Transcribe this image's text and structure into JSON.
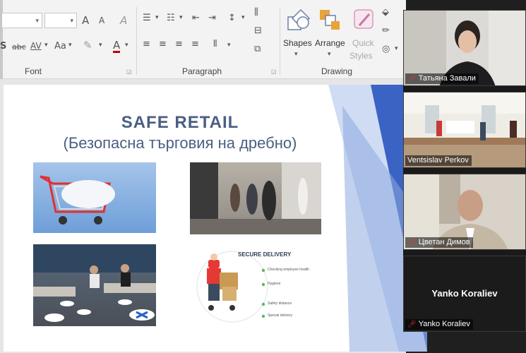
{
  "ribbon": {
    "groups": {
      "font": "Font",
      "paragraph": "Paragraph",
      "drawing": "Drawing"
    },
    "font": {
      "grow": "A",
      "shrink": "A",
      "clear": "A",
      "strike": "abc",
      "spacing": "AV",
      "case": "Aa",
      "color": "A",
      "shadow": "S"
    },
    "buttons": {
      "shapes": "Shapes",
      "arrange": "Arrange",
      "quick_styles_line1": "Quick",
      "quick_styles_line2": "Styles"
    }
  },
  "slide": {
    "title": "SAFE  RETAIL",
    "subtitle": "(Безопасна търговия на дребно)",
    "delivery": {
      "heading": "SECURE DELIVERY",
      "items": [
        "Checking employee health",
        "Hygiene",
        "Safety distance",
        "Special delivery"
      ]
    }
  },
  "participants": [
    {
      "name": "Татьяна Завали",
      "muted": true
    },
    {
      "name": "Ventsislav Perkov",
      "muted": false
    },
    {
      "name": "Цветан Димов",
      "muted": true
    },
    {
      "name": "Yanko Koraliev",
      "muted": true,
      "video_off": true,
      "display_name": "Yanko Koraliev"
    }
  ],
  "colors": {
    "slide_title": "#4a5f82",
    "ribbon_bg": "#f3f3f3",
    "muted_icon": "#e0332f",
    "slide_accent": "#3b63c4"
  }
}
